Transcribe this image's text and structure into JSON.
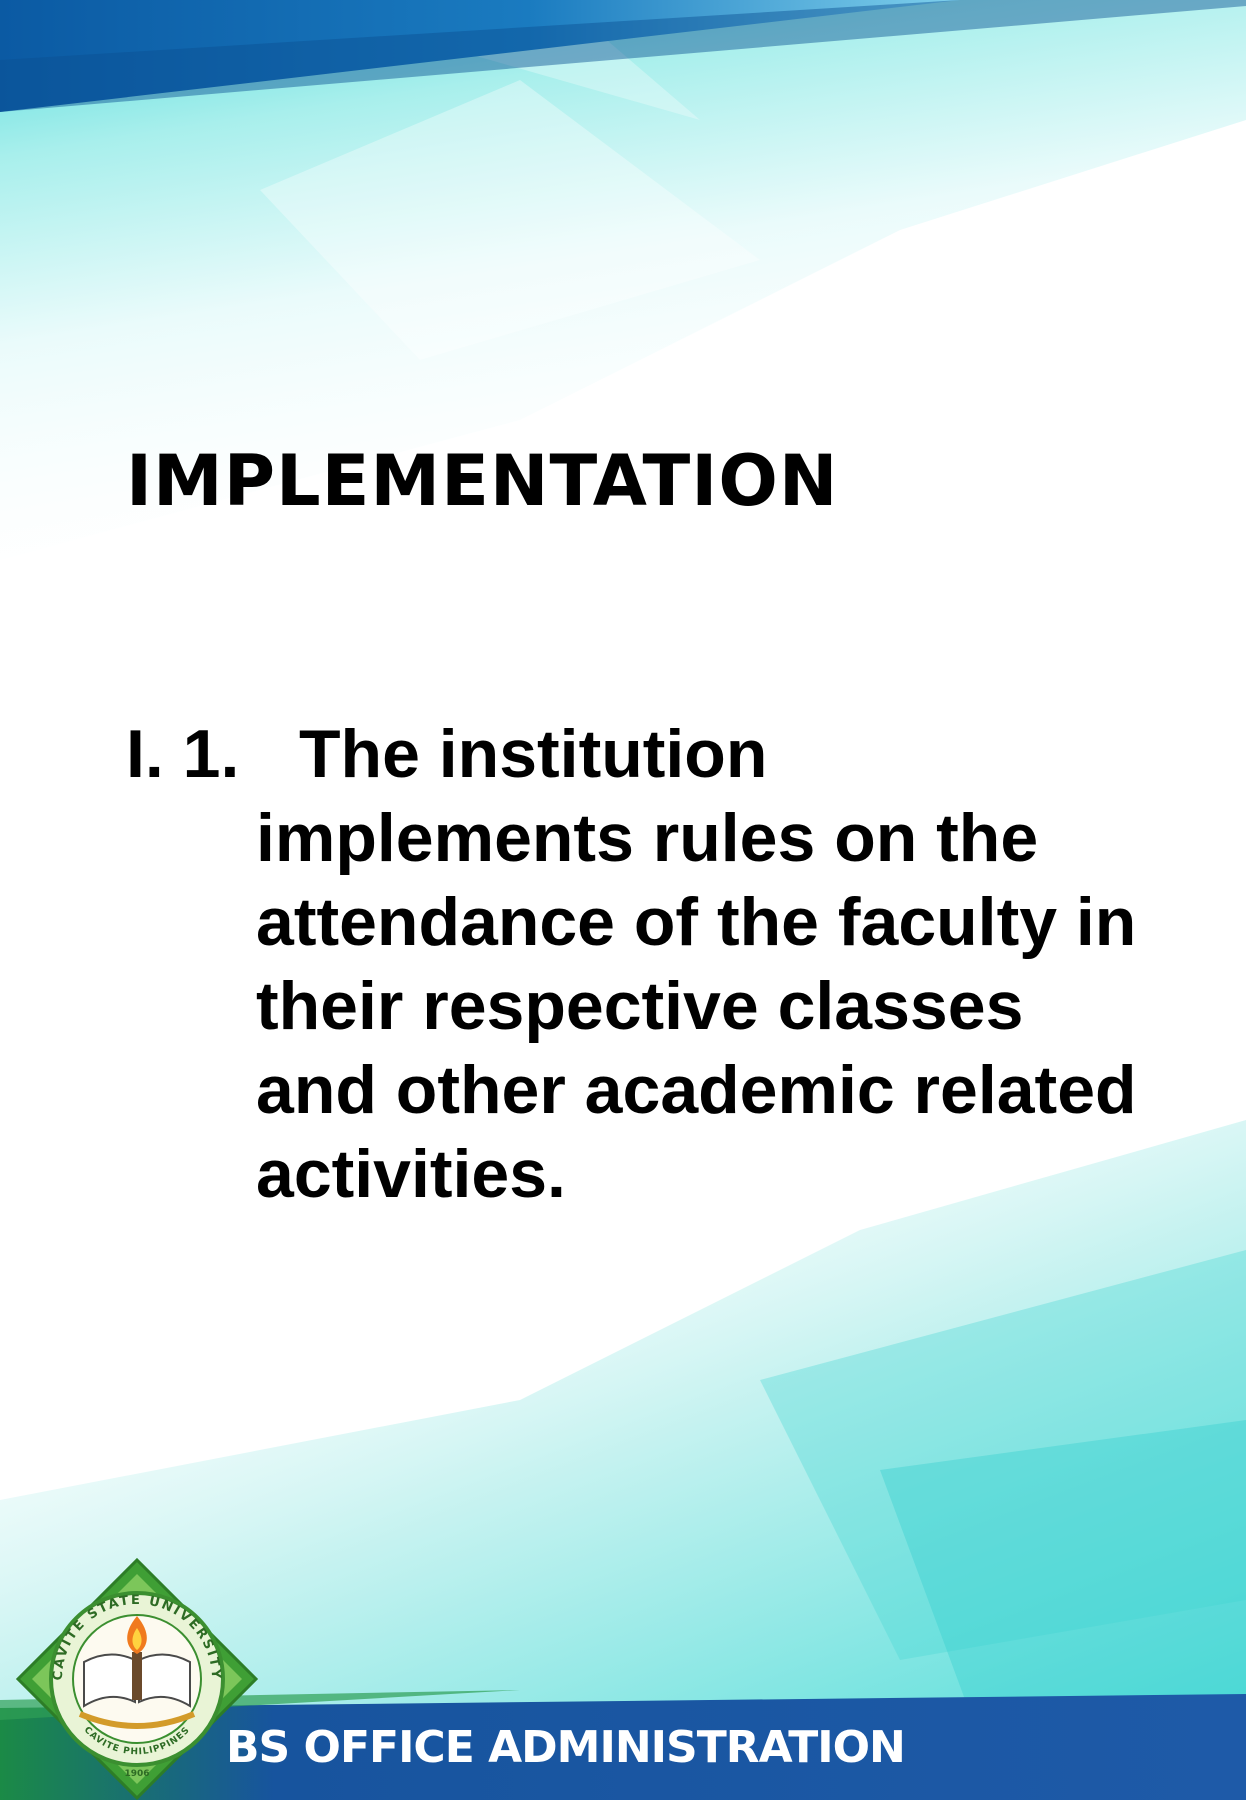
{
  "slide": {
    "title": "IMPLEMENTATION",
    "item": {
      "number": "I. 1.",
      "text": "The institution implements rules on the attendance of the faculty in their respective classes and other academic related activities."
    },
    "footer": {
      "label": "BS OFFICE ADMINISTRATION"
    },
    "logo": {
      "ring_text_top": "CAVITE STATE UNIVERSITY",
      "ring_text_bottom": "CAVITE PHILIPPINES",
      "year": "1906"
    }
  },
  "colors": {
    "top_band": "#0e63a8",
    "aqua": "#5fe0dc",
    "footer_band": "#1a4f9c",
    "logo_green": "#4fae3c",
    "text": "#000000"
  }
}
